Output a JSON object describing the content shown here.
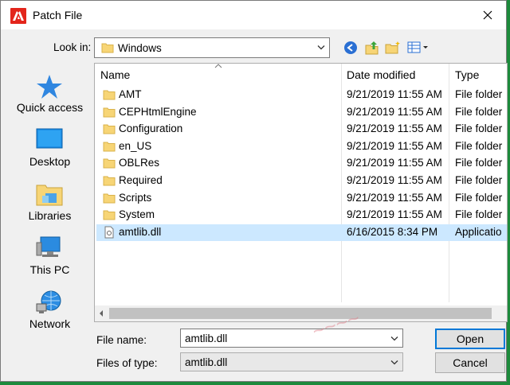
{
  "window": {
    "title": "Patch File"
  },
  "lookin": {
    "label": "Look in:",
    "value": "Windows"
  },
  "places": [
    {
      "label": "Quick access",
      "icon": "star-icon"
    },
    {
      "label": "Desktop",
      "icon": "desktop-icon"
    },
    {
      "label": "Libraries",
      "icon": "libraries-icon"
    },
    {
      "label": "This PC",
      "icon": "computer-icon"
    },
    {
      "label": "Network",
      "icon": "network-icon"
    }
  ],
  "columns": {
    "name": "Name",
    "date": "Date modified",
    "type": "Type"
  },
  "rows": [
    {
      "name": "AMT",
      "date": "9/21/2019 11:55 AM",
      "type": "File folder",
      "kind": "folder"
    },
    {
      "name": "CEPHtmlEngine",
      "date": "9/21/2019 11:55 AM",
      "type": "File folder",
      "kind": "folder"
    },
    {
      "name": "Configuration",
      "date": "9/21/2019 11:55 AM",
      "type": "File folder",
      "kind": "folder"
    },
    {
      "name": "en_US",
      "date": "9/21/2019 11:55 AM",
      "type": "File folder",
      "kind": "folder"
    },
    {
      "name": "OBLRes",
      "date": "9/21/2019 11:55 AM",
      "type": "File folder",
      "kind": "folder"
    },
    {
      "name": "Required",
      "date": "9/21/2019 11:55 AM",
      "type": "File folder",
      "kind": "folder"
    },
    {
      "name": "Scripts",
      "date": "9/21/2019 11:55 AM",
      "type": "File folder",
      "kind": "folder"
    },
    {
      "name": "System",
      "date": "9/21/2019 11:55 AM",
      "type": "File folder",
      "kind": "folder"
    },
    {
      "name": "amtlib.dll",
      "date": "6/16/2015 8:34 PM",
      "type": "Applicatio",
      "kind": "dll",
      "selected": true
    }
  ],
  "filename": {
    "label": "File name:",
    "value": "amtlib.dll"
  },
  "filetype": {
    "label": "Files of type:",
    "value": "amtlib.dll"
  },
  "buttons": {
    "open": "Open",
    "cancel": "Cancel"
  },
  "colors": {
    "accent": "#0078d7",
    "selection": "#cce8ff",
    "folder": "#f7d576",
    "adobe_red": "#e3251b"
  }
}
